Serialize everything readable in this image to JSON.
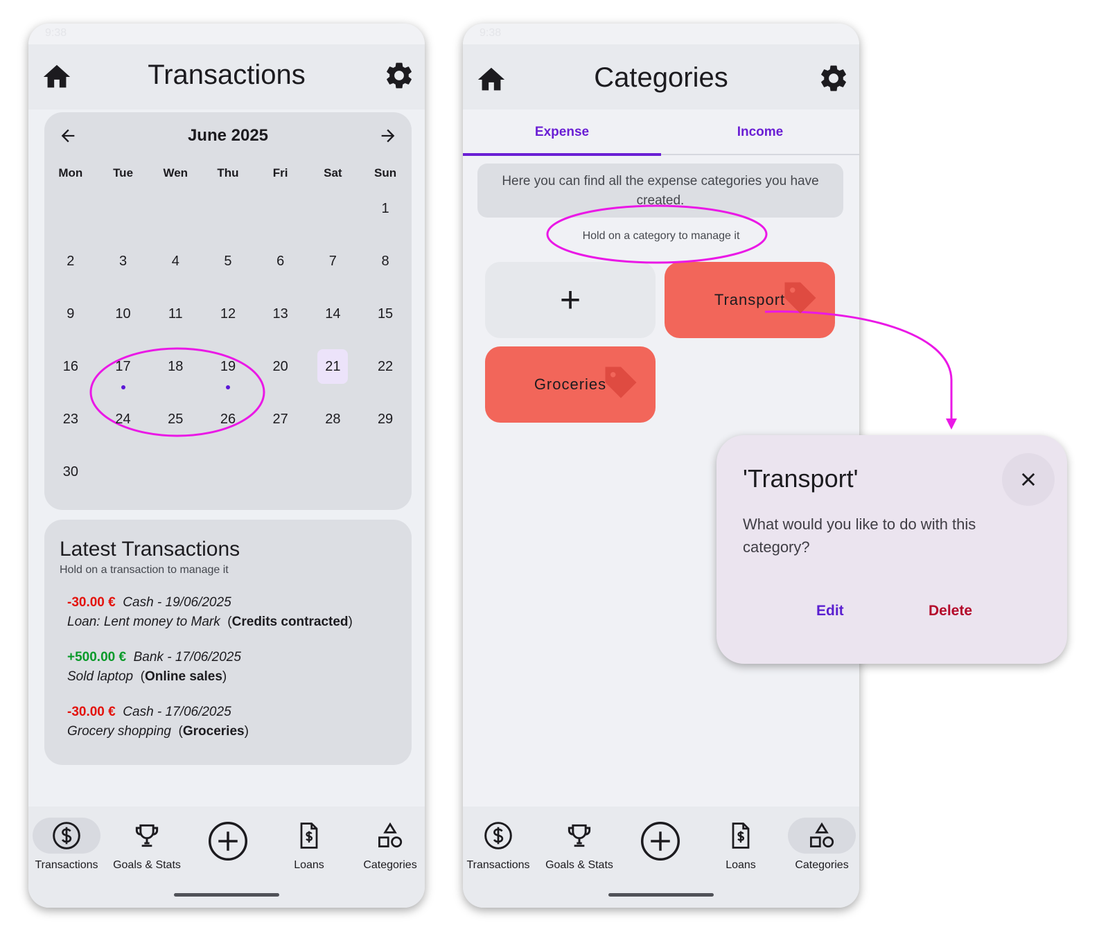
{
  "colors": {
    "accent": "#6a1fd4",
    "negative": "#e3120b",
    "positive": "#0a9a2a",
    "category_red": "#f2665a",
    "annotation_magenta": "#ea18e6",
    "delete_red": "#b4092b"
  },
  "left_screen": {
    "status_time": "9:38",
    "title": "Transactions",
    "calendar": {
      "month": "June 2025",
      "weekdays": [
        "Mon",
        "Tue",
        "Wen",
        "Thu",
        "Fri",
        "Sat",
        "Sun"
      ],
      "leading_blanks": 6,
      "days_in_month": 30,
      "today": 21,
      "days_with_transactions": [
        17,
        19
      ]
    },
    "latest": {
      "title": "Latest Transactions",
      "subtitle": "Hold on a transaction to manage it",
      "items": [
        {
          "amount": "-30.00 €",
          "meta": "Cash - 19/06/2025",
          "desc": "Loan: Lent money to Mark",
          "category": "Credits contracted"
        },
        {
          "amount": "+500.00 €",
          "meta": "Bank - 17/06/2025",
          "desc": "Sold laptop",
          "category": "Online sales"
        },
        {
          "amount": "-30.00 €",
          "meta": "Cash - 17/06/2025",
          "desc": "Grocery shopping",
          "category": "Groceries"
        }
      ]
    }
  },
  "right_screen": {
    "status_time": "9:38",
    "title": "Categories",
    "tabs": {
      "expense": "Expense",
      "income": "Income"
    },
    "info": "Here you can find all the expense categories you have created.",
    "hint": "Hold on a category to manage it",
    "add_symbol": "+",
    "categories": {
      "first": "Transport",
      "second": "Groceries"
    }
  },
  "nav": {
    "transactions": "Transactions",
    "goals": "Goals & Stats",
    "loans": "Loans",
    "categories": "Categories"
  },
  "dialog": {
    "title": "'Transport'",
    "text": "What would you like to do with this category?",
    "edit": "Edit",
    "delete": "Delete"
  }
}
